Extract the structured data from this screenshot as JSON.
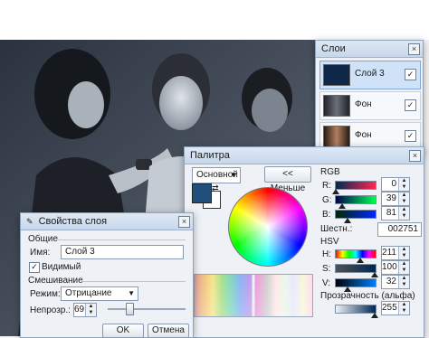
{
  "layers_panel": {
    "title": "Слои",
    "items": [
      {
        "label": "Слой 3",
        "checked": true,
        "selected": true,
        "thumb": "#0f2748"
      },
      {
        "label": "Фон",
        "checked": true,
        "selected": false,
        "thumb": "#3a3a3a"
      },
      {
        "label": "Фон",
        "checked": true,
        "selected": false,
        "thumb": "#2a2a2a"
      }
    ],
    "check_mark": "✓"
  },
  "palette_panel": {
    "title": "Палитра",
    "mode_select": "Основной",
    "less_button": "<< Меньше",
    "rgb_label": "RGB",
    "r_label": "R:",
    "r_value": "0",
    "g_label": "G:",
    "g_value": "39",
    "b_label": "B:",
    "b_value": "81",
    "hex_label": "Шестн.:",
    "hex_value": "002751",
    "hsv_label": "HSV",
    "h_label": "H:",
    "h_value": "211",
    "s_label": "S:",
    "s_value": "100",
    "v_label": "V:",
    "v_value": "32",
    "alpha_label": "Прозрачность (альфа)",
    "alpha_value": "255",
    "primary_color": "#1f4f7a",
    "secondary_color": "#ffffff"
  },
  "layer_props": {
    "title": "Свойства слоя",
    "general_section": "Общие",
    "name_label": "Имя:",
    "name_value": "Слой 3",
    "visible_label": "Видимый",
    "visible_checked": "✓",
    "blend_section": "Смешивание",
    "mode_label": "Режим:",
    "mode_value": "Отрицание",
    "opacity_label": "Непрозр.:",
    "opacity_value": "69",
    "ok_button": "OK",
    "cancel_button": "Отмена"
  },
  "window_close_glyph": "×"
}
